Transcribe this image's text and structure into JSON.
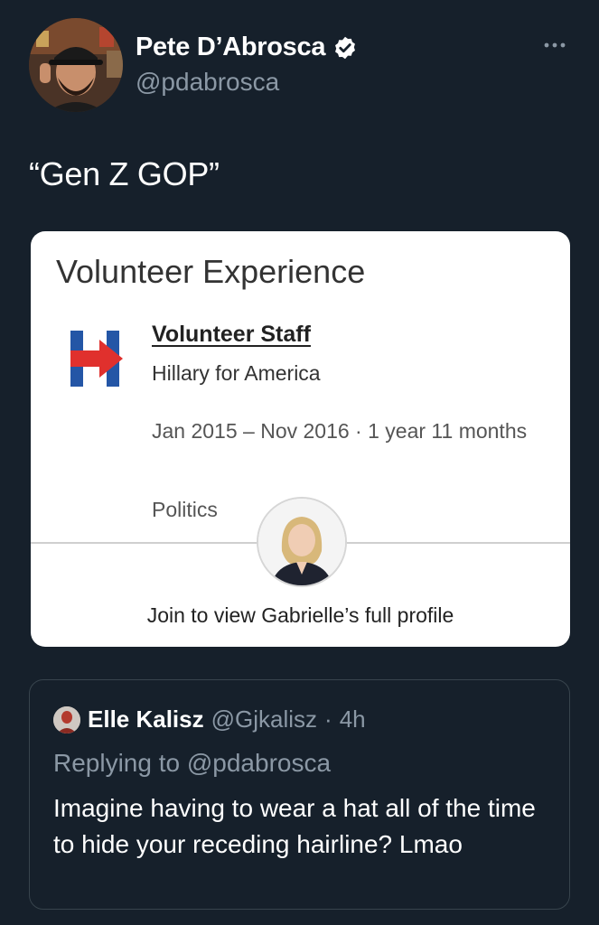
{
  "author": {
    "display_name": "Pete D’Abrosca",
    "handle": "@pdabrosca",
    "verified": true,
    "avatar_icon": "profile-photo-man-in-cap"
  },
  "tweet": {
    "text": "“Gen Z GOP”"
  },
  "media": {
    "section_title": "Volunteer Experience",
    "logo_icon": "hillary-campaign-h-logo",
    "role": "Volunteer Staff",
    "organization": "Hillary for America",
    "dates": "Jan 2015 – Nov 2016 · 1 year 11 months",
    "cause": "Politics",
    "profile_photo_icon": "profile-photo-woman",
    "cta": "Join to view Gabrielle’s full profile"
  },
  "quoted_tweet": {
    "display_name": "Elle Kalisz",
    "handle": "@Gjkalisz",
    "separator": "·",
    "time": "4h",
    "replying_to": "Replying to @pdabrosca",
    "text": "Imagine having to wear a hat all of the time to hide your receding hairline? Lmao"
  },
  "colors": {
    "background": "#16202b",
    "secondary_text": "#8b98a5",
    "logo_blue": "#2456a6",
    "logo_red": "#e0302d"
  }
}
